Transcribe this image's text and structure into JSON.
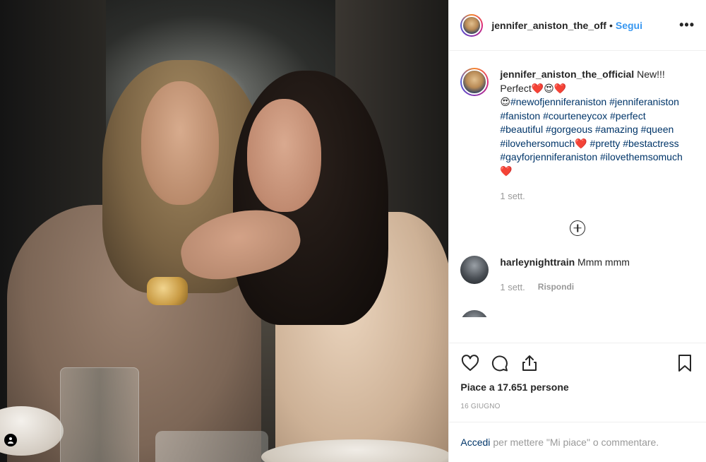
{
  "post": {
    "username_short": "jennifer_aniston_the_off",
    "follow_label": "Segui",
    "dot": "•",
    "more_label": "•••"
  },
  "caption": {
    "username": "jennifer_aniston_the_official",
    "text_start": " New!!! Perfect",
    "emoji_heart": "❤️",
    "emoji_face": "😍",
    "hashtags_1": "#newofjenniferaniston #jenniferaniston #faniston #courteneycox #perfect #beautiful #gorgeous #amazing #queen #ilovehersomuch",
    "hashtags_2": " #pretty #bestactress #gayforjenniferaniston #ilovethemsomuch",
    "time": "1 sett."
  },
  "comments": [
    {
      "username": "harleynighttrain",
      "text": "Mmm mmm",
      "time": "1 sett.",
      "reply_label": "Rispondi"
    }
  ],
  "cut_comment": "______ ______ ______ ______ __________ _ ______",
  "actions": {
    "likes_text": "Piace a 17.651 persone",
    "date": "16 GIUGNO"
  },
  "login": {
    "link": "Accedi",
    "text": "per mettere \"Mi piace\" o commentare."
  },
  "icons": [
    "heart-icon",
    "comment-icon",
    "share-icon",
    "bookmark-icon",
    "add-circle-icon",
    "user-tag-icon"
  ],
  "colors": {
    "link_blue": "#3897f0",
    "hashtag_blue": "#003569",
    "meta_gray": "#999999",
    "heart_red": "#ed1c24"
  }
}
